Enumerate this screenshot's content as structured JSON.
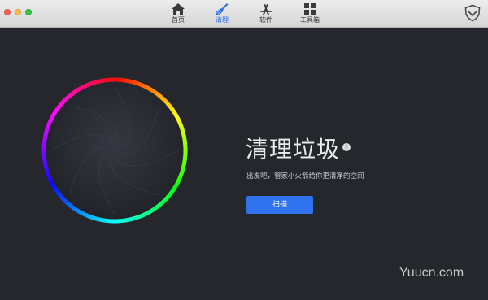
{
  "window": {
    "traffic_lights": [
      "close",
      "minimize",
      "maximize"
    ]
  },
  "toolbar": {
    "tabs": [
      {
        "label": "首页",
        "icon": "home-icon",
        "active": false
      },
      {
        "label": "清理",
        "icon": "broom-icon",
        "active": true
      },
      {
        "label": "软件",
        "icon": "app-store-icon",
        "active": false
      },
      {
        "label": "工具箱",
        "icon": "grid-icon",
        "active": false
      }
    ],
    "shield_icon": "shield-icon"
  },
  "main": {
    "title": "清理垃圾",
    "info_icon": "info-icon",
    "info_glyph": "i",
    "subtitle": "出发吧，管家小火箭给你更清净的空间",
    "scan_button": "扫描"
  },
  "watermark": "Yuucn.com",
  "colors": {
    "accent": "#2f73ee",
    "background": "#25272d",
    "active_tab": "#2f6fe6"
  }
}
